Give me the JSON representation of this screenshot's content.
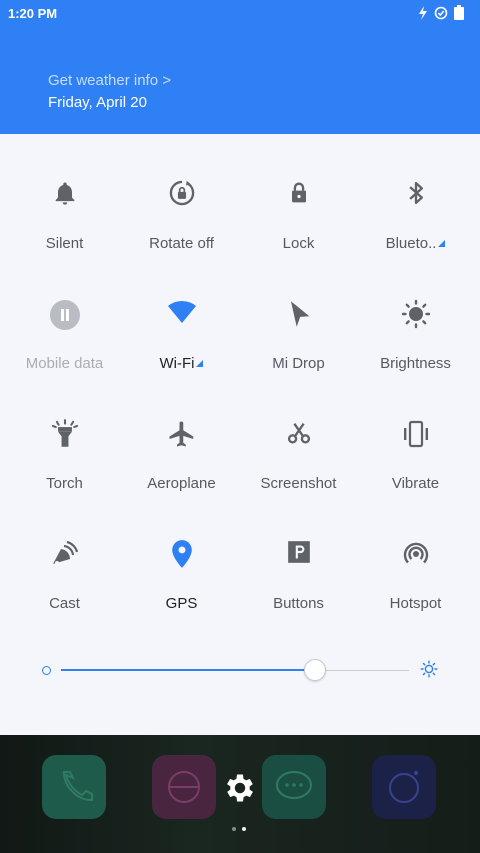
{
  "status_bar": {
    "time": "1:20 PM"
  },
  "header": {
    "weather_link": "Get weather info >",
    "date": "Friday, April 20"
  },
  "tiles": [
    {
      "label": "Silent",
      "icon": "bell-icon",
      "state": "off"
    },
    {
      "label": "Rotate off",
      "icon": "rotate-lock-icon",
      "state": "off"
    },
    {
      "label": "Lock",
      "icon": "lock-icon",
      "state": "off"
    },
    {
      "label": "Blueto..",
      "icon": "bluetooth-icon",
      "state": "off",
      "expand": true
    },
    {
      "label": "Mobile data",
      "icon": "pause-icon",
      "state": "disabled"
    },
    {
      "label": "Wi-Fi",
      "icon": "wifi-icon",
      "state": "on",
      "expand": true
    },
    {
      "label": "Mi Drop",
      "icon": "mi-drop-icon",
      "state": "off"
    },
    {
      "label": "Brightness",
      "icon": "sun-icon",
      "state": "off"
    },
    {
      "label": "Torch",
      "icon": "torch-icon",
      "state": "off"
    },
    {
      "label": "Aeroplane",
      "icon": "airplane-icon",
      "state": "off"
    },
    {
      "label": "Screenshot",
      "icon": "scissors-icon",
      "state": "off"
    },
    {
      "label": "Vibrate",
      "icon": "vibrate-icon",
      "state": "off"
    },
    {
      "label": "Cast",
      "icon": "cast-icon",
      "state": "off"
    },
    {
      "label": "GPS",
      "icon": "location-pin-icon",
      "state": "on"
    },
    {
      "label": "Buttons",
      "icon": "buttons-p-icon",
      "state": "off"
    },
    {
      "label": "Hotspot",
      "icon": "hotspot-icon",
      "state": "off"
    }
  ],
  "brightness": {
    "level": 0.73
  },
  "colors": {
    "accent": "#2f80f4",
    "icon_gray": "#5f6368",
    "disabled": "#a9adb3"
  },
  "dock": [
    {
      "icon": "phone-icon",
      "color": "#1f5b4a"
    },
    {
      "icon": "browser-icon",
      "color": "#5b2b4a"
    },
    {
      "icon": "messages-icon",
      "color": "#1f5a4c"
    },
    {
      "icon": "camera-icon",
      "color": "#20254a"
    }
  ]
}
